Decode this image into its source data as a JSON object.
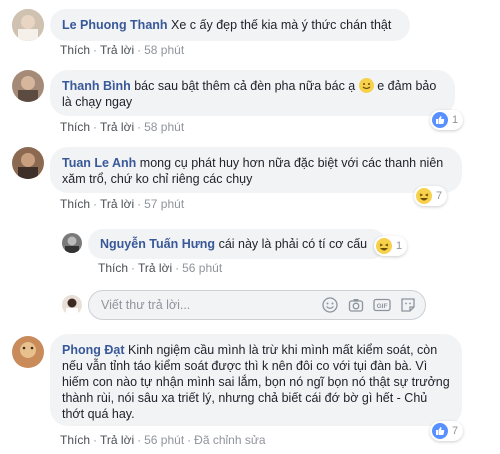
{
  "comments": [
    {
      "author": "Le Phuong Thanh",
      "text": "Xe c ấy đẹp thế kia mà ý thức chán thật",
      "like": "Thích",
      "reply": "Trả lời",
      "time": "58 phút"
    },
    {
      "author": "Thanh Bình",
      "text_before": "bác sau bật thêm cả đèn pha nữa bác ạ",
      "text_after": "e đảm bảo là chạy ngay",
      "like": "Thích",
      "reply": "Trả lời",
      "time": "58 phút",
      "reaction_count": "1",
      "reaction_icon": "like-icon"
    },
    {
      "author": "Tuan Le Anh",
      "text": "mong cụ phát huy hơn nữa đặc biệt với các thanh niên xăm trổ, chứ ko chỉ riêng các chụy",
      "like": "Thích",
      "reply": "Trả lời",
      "time": "57 phút",
      "reaction_count": "7",
      "reaction_icon": "haha-icon"
    },
    {
      "author": "Nguyễn Tuấn Hưng",
      "text": "cái này là phải có tí cơ cấu",
      "like": "Thích",
      "reply": "Trả lời",
      "time": "56 phút",
      "reaction_count": "1",
      "reaction_icon": "haha-icon"
    },
    {
      "author": "Phong Đạt",
      "text": "Kinh ngiệm cầu mình là trừ khi mình mất kiểm soát, còn nếu vẫn tỉnh táo kiểm soát được thì k nên đôi co với tụi đàn bà. Vì hiếm con nào tự nhận mình sai lắm, bọn nó ngĩ bọn nó thật sự trưởng thành rùi, nói sâu xa triết lý, nhưng chả biết cái đớ bờ gì hết - Chủ thớt quá hay.",
      "like": "Thích",
      "reply": "Trả lời",
      "time": "56 phút",
      "edited": "Đã chỉnh sửa",
      "reaction_count": "7",
      "reaction_icon": "like-icon"
    }
  ],
  "reply_box": {
    "placeholder": "Viết thư trả lời...",
    "icons": [
      "emoji-icon",
      "camera-icon",
      "gif-icon",
      "sticker-icon"
    ]
  },
  "colors": {
    "author": "#385898",
    "bubble": "#f2f3f5",
    "meta": "#90949c",
    "like_blue": "#5890ff",
    "haha_yellow": "#f7d14b"
  }
}
